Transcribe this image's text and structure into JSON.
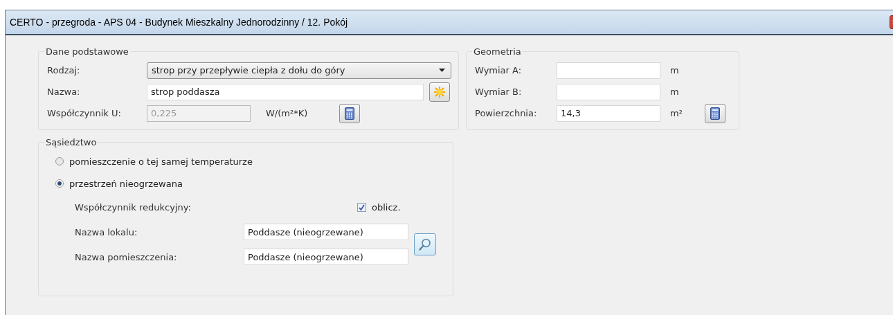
{
  "window": {
    "title": "CERTO - przegroda - APS 04 - Budynek Mieszkalny Jednorodzinny / 12. Pokój"
  },
  "basic": {
    "legend": "Dane podstawowe",
    "type": {
      "label": "Rodzaj:",
      "value": "strop przy przepływie ciepła z dołu do góry"
    },
    "name": {
      "label": "Nazwa:",
      "value": "strop poddasza"
    },
    "u": {
      "label": "Współczynnik U:",
      "value": "0,225",
      "unit": "W/(m²*K)",
      "disabled": true
    }
  },
  "geometry": {
    "legend": "Geometria",
    "fields": [
      {
        "label": "Wymiar A:",
        "unit": "m",
        "calc": false
      },
      {
        "label": "Wymiar B:",
        "unit": "m",
        "calc": false
      },
      {
        "label": "Powierzchnia:",
        "value": "14,3",
        "unit": "m²",
        "calc": true
      }
    ]
  },
  "neighbourhood": {
    "legend": "Sąsiedztwo",
    "options": [
      {
        "label": "pomieszczenie o tej samej temperaturze",
        "selected": false
      },
      {
        "label": "przestrzeń nieogrzewana",
        "selected": true
      }
    ],
    "reduction": {
      "label": "Współczynnik redukcyjny:",
      "check_label": "oblicz.",
      "checked": true
    },
    "unit_name": {
      "label": "Nazwa lokalu:",
      "value": "Poddasze (nieogrzewane)"
    },
    "room_name": {
      "label": "Nazwa pomieszczenia:",
      "value": "Poddasze (nieogrzewane)"
    }
  }
}
